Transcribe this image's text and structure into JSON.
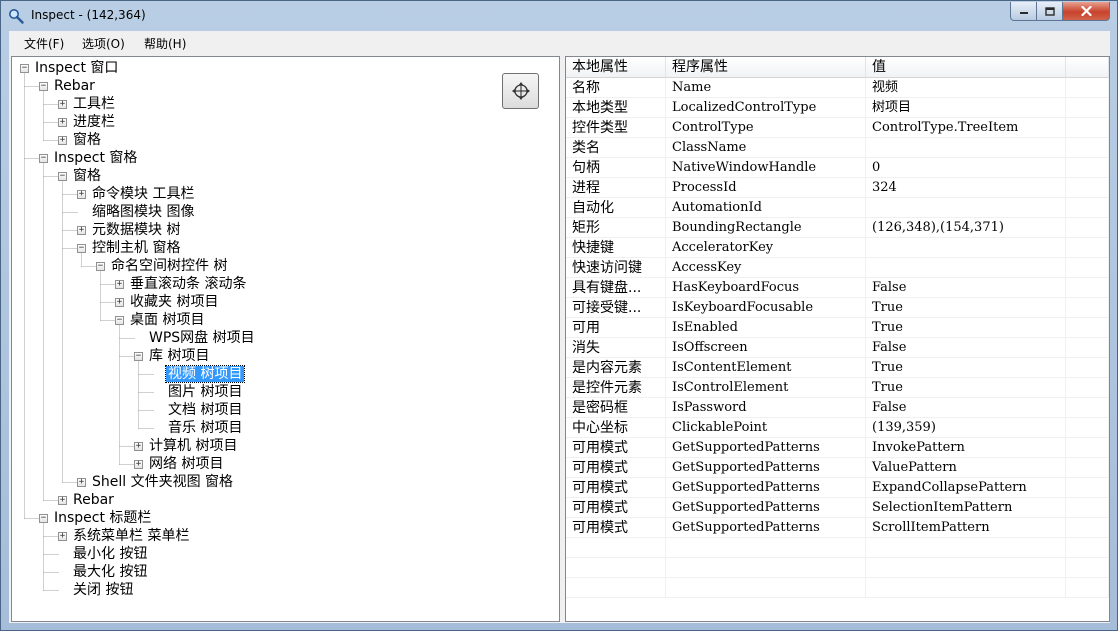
{
  "window": {
    "title": "Inspect - (142,364)"
  },
  "menu": [
    "文件(F)",
    "选项(O)",
    "帮助(H)"
  ],
  "tree": [
    {
      "label": "Inspect 窗口",
      "depth": 0,
      "expander": "minus",
      "selected": false
    },
    {
      "label": "Rebar",
      "depth": 1,
      "expander": "minus",
      "selected": false
    },
    {
      "label": "工具栏",
      "depth": 2,
      "expander": "plus",
      "selected": false
    },
    {
      "label": "进度栏",
      "depth": 2,
      "expander": "plus",
      "selected": false
    },
    {
      "label": "窗格",
      "depth": 2,
      "expander": "plus",
      "selected": false
    },
    {
      "label": "Inspect 窗格",
      "depth": 1,
      "expander": "minus",
      "selected": false
    },
    {
      "label": "窗格",
      "depth": 2,
      "expander": "minus",
      "selected": false
    },
    {
      "label": "命令模块 工具栏",
      "depth": 3,
      "expander": "plus",
      "selected": false
    },
    {
      "label": "缩略图模块 图像",
      "depth": 3,
      "expander": "none",
      "selected": false
    },
    {
      "label": "元数据模块 树",
      "depth": 3,
      "expander": "plus",
      "selected": false
    },
    {
      "label": "控制主机 窗格",
      "depth": 3,
      "expander": "minus",
      "selected": false
    },
    {
      "label": "命名空间树控件 树",
      "depth": 4,
      "expander": "minus",
      "selected": false
    },
    {
      "label": "垂直滚动条 滚动条",
      "depth": 5,
      "expander": "plus",
      "selected": false
    },
    {
      "label": "收藏夹 树项目",
      "depth": 5,
      "expander": "plus",
      "selected": false
    },
    {
      "label": "桌面 树项目",
      "depth": 5,
      "expander": "minus",
      "selected": false
    },
    {
      "label": "WPS网盘 树项目",
      "depth": 6,
      "expander": "none",
      "selected": false
    },
    {
      "label": "库 树项目",
      "depth": 6,
      "expander": "minus",
      "selected": false
    },
    {
      "label": "视频 树项目",
      "depth": 7,
      "expander": "none",
      "selected": true
    },
    {
      "label": "图片 树项目",
      "depth": 7,
      "expander": "none",
      "selected": false
    },
    {
      "label": "文档 树项目",
      "depth": 7,
      "expander": "none",
      "selected": false
    },
    {
      "label": "音乐 树项目",
      "depth": 7,
      "expander": "none",
      "selected": false
    },
    {
      "label": "计算机 树项目",
      "depth": 6,
      "expander": "plus",
      "selected": false
    },
    {
      "label": "网络 树项目",
      "depth": 6,
      "expander": "plus",
      "selected": false
    },
    {
      "label": "Shell 文件夹视图 窗格",
      "depth": 3,
      "expander": "plus",
      "selected": false
    },
    {
      "label": "Rebar",
      "depth": 2,
      "expander": "plus",
      "selected": false
    },
    {
      "label": "Inspect 标题栏",
      "depth": 1,
      "expander": "minus",
      "selected": false
    },
    {
      "label": "系统菜单栏 菜单栏",
      "depth": 2,
      "expander": "plus",
      "selected": false
    },
    {
      "label": "最小化 按钮",
      "depth": 2,
      "expander": "none",
      "selected": false
    },
    {
      "label": "最大化 按钮",
      "depth": 2,
      "expander": "none",
      "selected": false
    },
    {
      "label": "关闭 按钮",
      "depth": 2,
      "expander": "none",
      "selected": false
    }
  ],
  "properties": {
    "headers": [
      "本地属性",
      "程序属性",
      "值"
    ],
    "rows": [
      [
        "名称",
        "Name",
        "视频"
      ],
      [
        "本地类型",
        "LocalizedControlType",
        "树项目"
      ],
      [
        "控件类型",
        "ControlType",
        "ControlType.TreeItem"
      ],
      [
        "类名",
        "ClassName",
        ""
      ],
      [
        "句柄",
        "NativeWindowHandle",
        "0"
      ],
      [
        "进程",
        "ProcessId",
        "324"
      ],
      [
        "自动化",
        "AutomationId",
        ""
      ],
      [
        "矩形",
        "BoundingRectangle",
        "(126,348),(154,371)"
      ],
      [
        "快捷键",
        "AcceleratorKey",
        ""
      ],
      [
        "快速访问键",
        "AccessKey",
        ""
      ],
      [
        "具有键盘...",
        "HasKeyboardFocus",
        "False"
      ],
      [
        "可接受键...",
        "IsKeyboardFocusable",
        "True"
      ],
      [
        "可用",
        "IsEnabled",
        "True"
      ],
      [
        "消失",
        "IsOffscreen",
        "False"
      ],
      [
        "是内容元素",
        "IsContentElement",
        "True"
      ],
      [
        "是控件元素",
        "IsControlElement",
        "True"
      ],
      [
        "是密码框",
        "IsPassword",
        "False"
      ],
      [
        "中心坐标",
        "ClickablePoint",
        "(139,359)"
      ],
      [
        "可用模式",
        "GetSupportedPatterns",
        "InvokePattern"
      ],
      [
        "可用模式",
        "GetSupportedPatterns",
        "ValuePattern"
      ],
      [
        "可用模式",
        "GetSupportedPatterns",
        "ExpandCollapsePattern"
      ],
      [
        "可用模式",
        "GetSupportedPatterns",
        "SelectionItemPattern"
      ],
      [
        "可用模式",
        "GetSupportedPatterns",
        "ScrollItemPattern"
      ]
    ]
  },
  "icons": {
    "app": "magnifier-icon",
    "highlight": "move-crosshair-icon"
  }
}
